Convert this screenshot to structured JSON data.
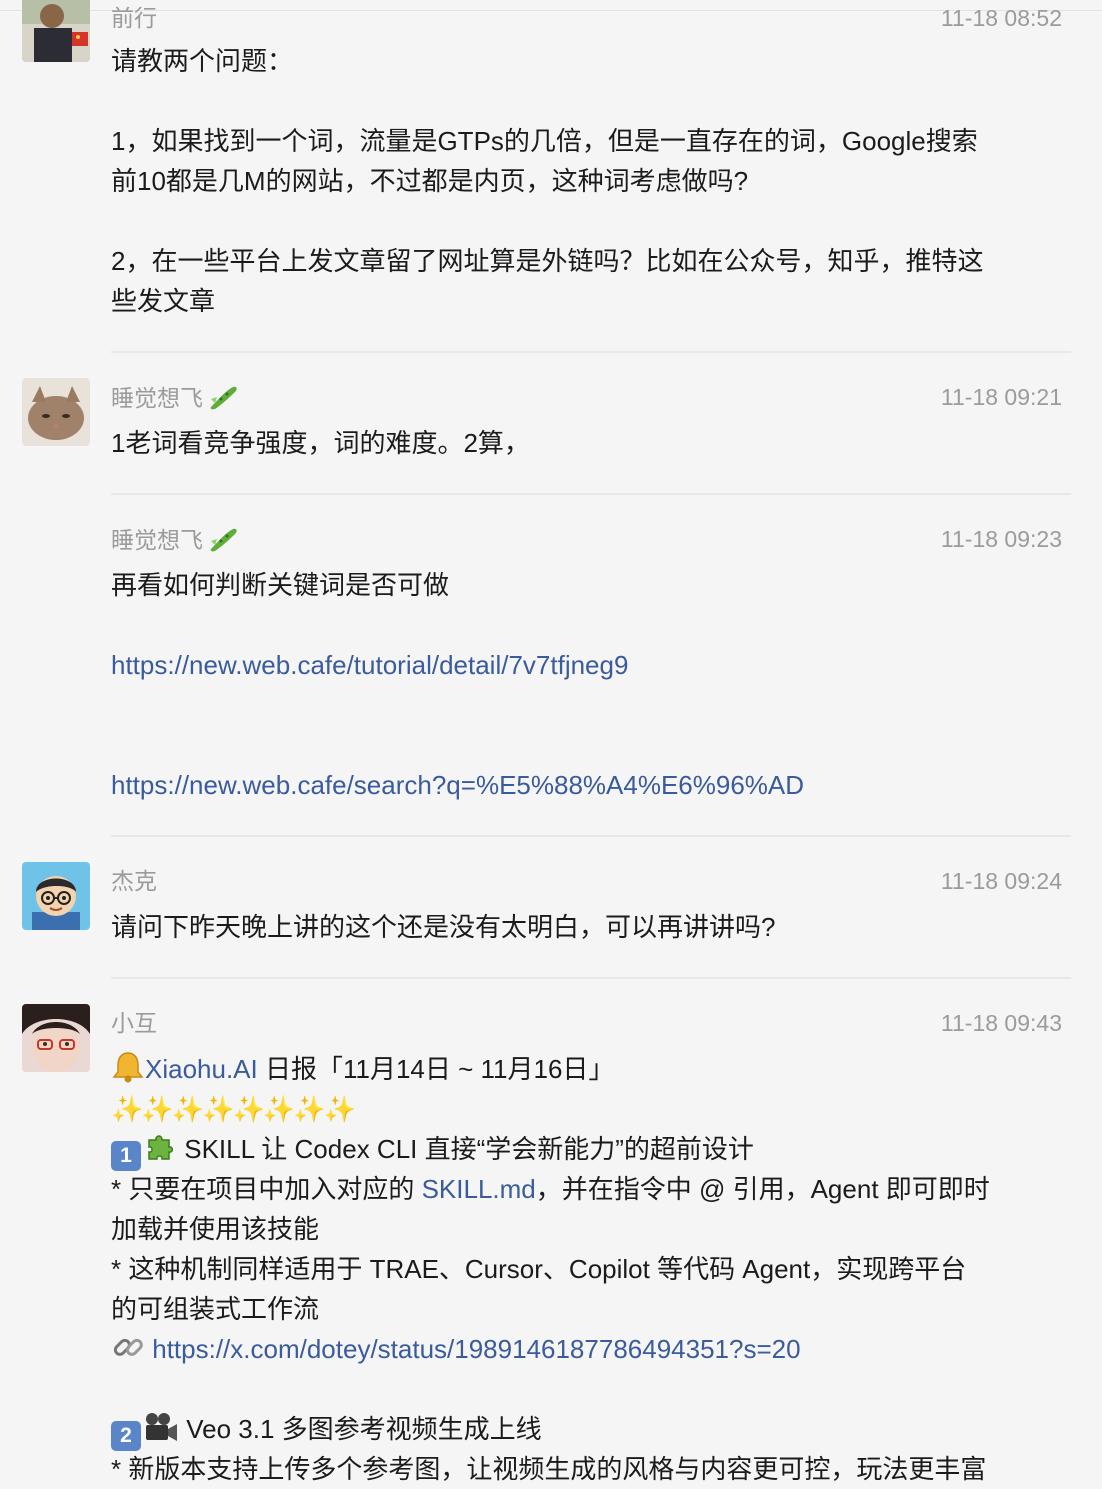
{
  "messages": [
    {
      "name": "前行",
      "time": "11-18 08:52",
      "lines": [
        "请教两个问题：",
        "1，如果找到一个词，流量是GTPs的几倍，但是一直存在的词，Google搜索",
        "前10都是几M的网站，不过都是内页，这种词考虑做吗?",
        "2，在一些平台上发文章留了网址算是外链吗？比如在公众号，知乎，推特这",
        "些发文章"
      ]
    },
    {
      "name": "睡觉想飞",
      "time": "11-18 09:21",
      "lines": [
        "1老词看竞争强度，词的难度。2算，"
      ]
    },
    {
      "name": "睡觉想飞",
      "time": "11-18 09:23",
      "lines": [
        "再看如何判断关键词是否可做"
      ],
      "links": [
        "https://new.web.cafe/tutorial/detail/7v7tfjneg9",
        "https://new.web.cafe/search?q=%E5%88%A4%E6%96%AD"
      ]
    },
    {
      "name": "杰克",
      "time": "11-18 09:24",
      "lines": [
        "请问下昨天晚上讲的这个还是没有太明白，可以再讲讲吗?"
      ]
    },
    {
      "name": "小互",
      "time": "11-18 09:43",
      "post": {
        "head_link": "Xiaohu.AI",
        "head_text": " 日报「11月14日 ~ 11月16日」",
        "sparkles": "✨✨✨✨✨✨✨✨",
        "item1_key": "1",
        "item1_title": " SKILL 让 Codex CLI 直接“学会新能力”的超前设计",
        "item1_b1_pre": "* 只要在项目中加入对应的 ",
        "item1_b1_link": "SKILL.md",
        "item1_b1_post": "，并在指令中 @ 引用，Agent 即可即时",
        "item1_b1_cont": "加载并使用该技能",
        "item1_b2": "* 这种机制同样适用于 TRAE、Cursor、Copilot 等代码 Agent，实现跨平台",
        "item1_b2_cont": "的可组装式工作流",
        "item1_link": "https://x.com/dotey/status/1989146187786494351?s=20",
        "item2_key": "2",
        "item2_title": " Veo 3.1 多图参考视频生成上线",
        "item2_b1": "* 新版本支持上传多个参考图，让视频生成的风格与内容更可控，玩法更丰富"
      }
    }
  ]
}
